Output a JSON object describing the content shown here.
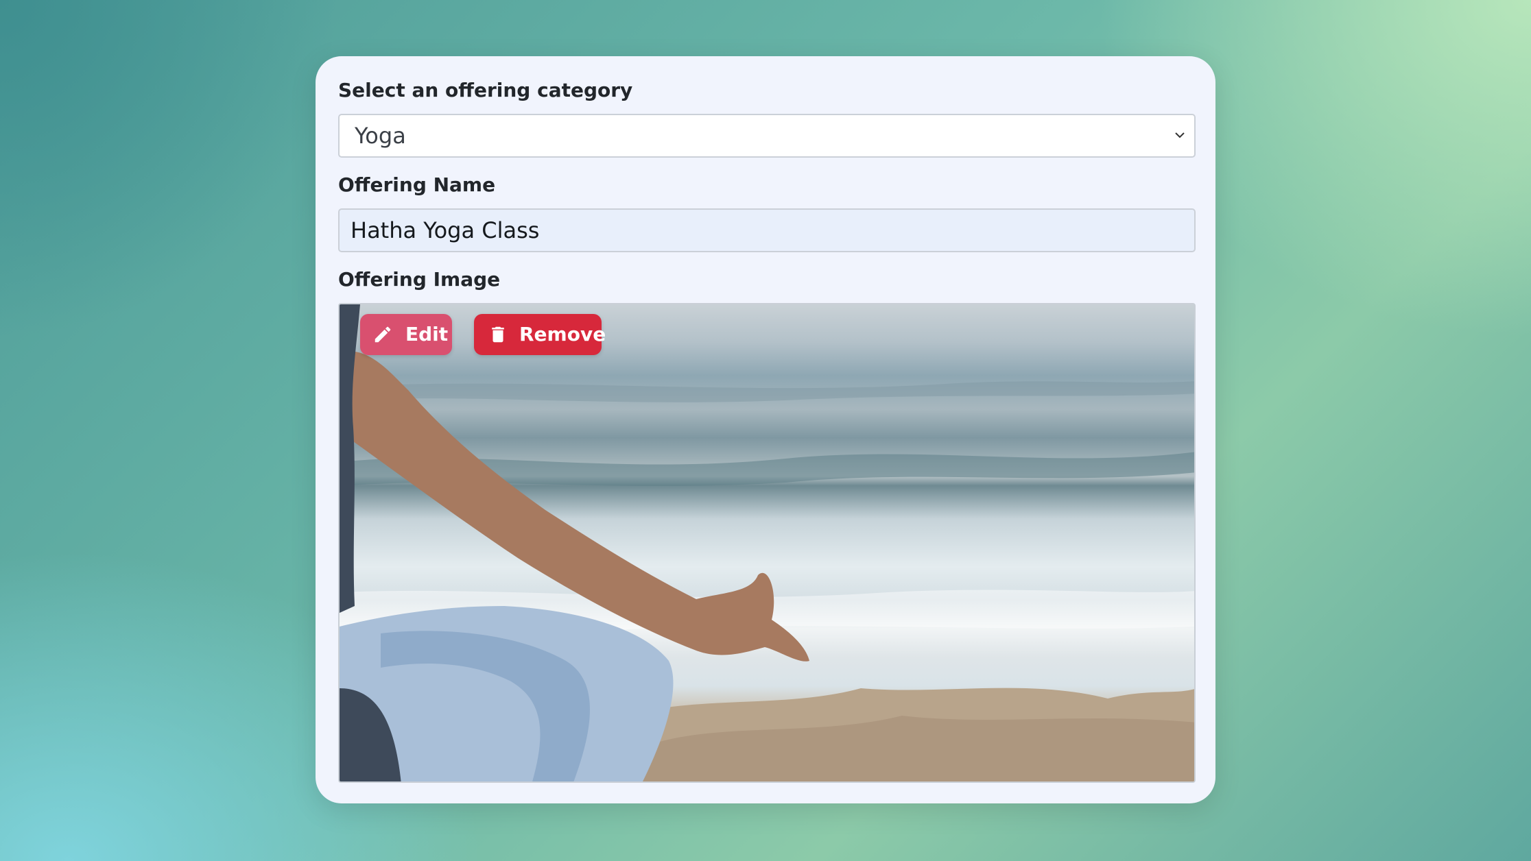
{
  "form": {
    "category_label": "Select an offering category",
    "category_value": "Yoga",
    "name_label": "Offering Name",
    "name_value": "Hatha Yoga Class",
    "image_label": "Offering Image",
    "edit_label": "Edit",
    "remove_label": "Remove"
  },
  "icons": {
    "select": "chevron-down-icon",
    "edit": "pencil-icon",
    "remove": "trash-icon"
  },
  "colors": {
    "edit_button": "#d9506f",
    "remove_button": "#d7283b",
    "card_background": "#f1f4fd"
  }
}
